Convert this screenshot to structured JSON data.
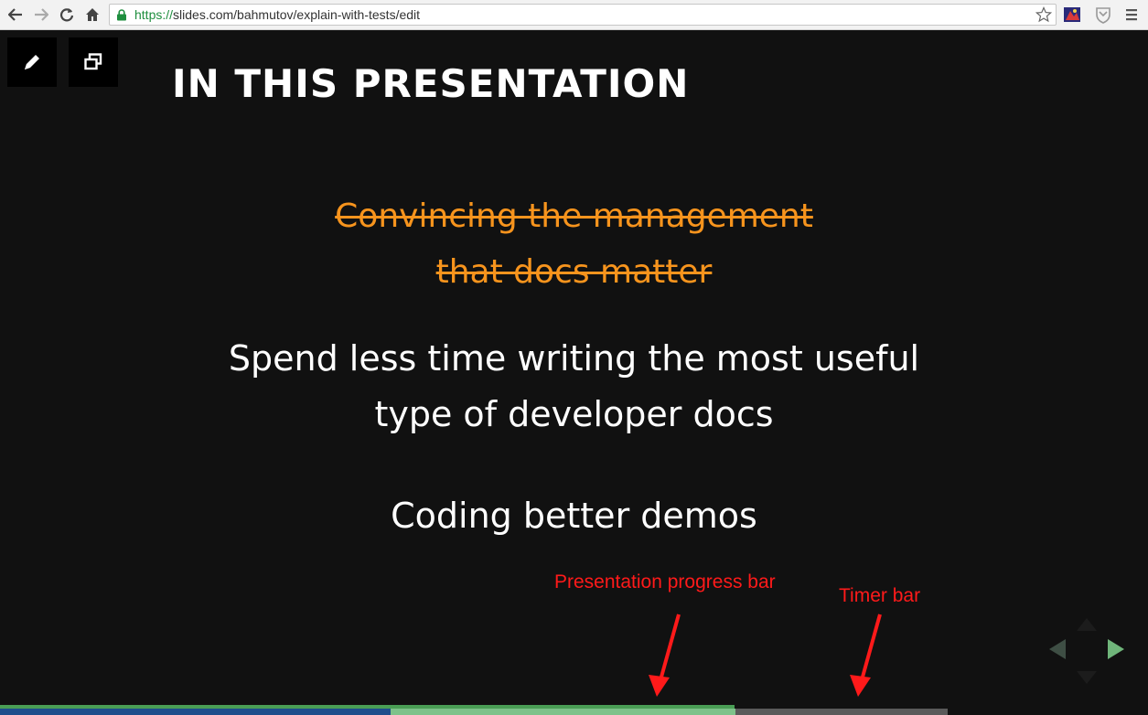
{
  "browser": {
    "url_scheme": "https://",
    "url_rest": "slides.com/bahmutov/explain-with-tests/edit"
  },
  "slide": {
    "title": "IN THIS PRESENTATION",
    "struck_lines": [
      "Convincing the management",
      "that docs matter"
    ],
    "point1_lines": [
      "Spend less time writing the most useful",
      "type of developer docs"
    ],
    "point2": "Coding better demos"
  },
  "annotations": {
    "progress_label": "Presentation progress bar",
    "timer_label": "Timer bar"
  },
  "progress": {
    "presentation_fraction": 0.64,
    "timer_fraction": 0.34
  },
  "colors": {
    "slide_bg": "#111111",
    "struck_text": "#f7941d",
    "annotation": "#ff1a1a",
    "progress_bar": "#4a9e55",
    "timer_bar": "#1f4e8c",
    "nav_active": "#6fb57a",
    "nav_inactive": "#3e4e44"
  },
  "icons": {
    "back": "back-arrow-icon",
    "forward": "forward-arrow-icon",
    "reload": "reload-icon",
    "home": "home-icon",
    "lock": "lock-icon",
    "star": "bookmark-star-icon",
    "pen": "pen-icon",
    "windows": "overlapping-windows-icon"
  }
}
